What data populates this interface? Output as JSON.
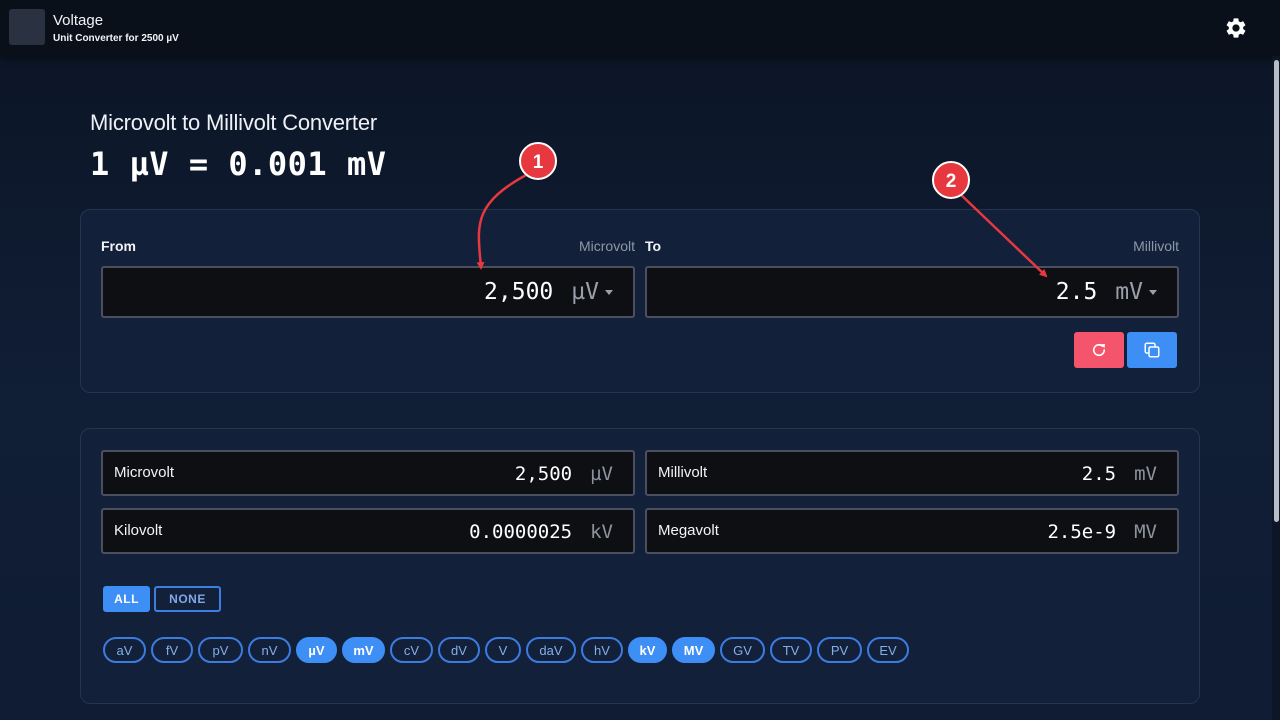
{
  "app": {
    "title": "Voltage",
    "subtitle": "Unit Converter for 2500 µV",
    "settings_icon": "gear-icon"
  },
  "main": {
    "title": "Microvolt to Millivolt Converter",
    "equation": "1 µV = 0.001 mV"
  },
  "converter": {
    "from": {
      "label": "From",
      "unit_name": "Microvolt",
      "value": "2,500",
      "unit": "µV"
    },
    "to": {
      "label": "To",
      "unit_name": "Millivolt",
      "value": "2.5",
      "unit": "mV"
    },
    "reset_icon": "refresh-icon",
    "copy_icon": "copy-icon"
  },
  "results": [
    {
      "label": "Microvolt",
      "value": "2,500",
      "unit": "µV"
    },
    {
      "label": "Millivolt",
      "value": "2.5",
      "unit": "mV"
    },
    {
      "label": "Kilovolt",
      "value": "0.0000025",
      "unit": "kV"
    },
    {
      "label": "Megavolt",
      "value": "2.5e-9",
      "unit": "MV"
    }
  ],
  "filters": {
    "all_label": "ALL",
    "none_label": "NONE",
    "units": [
      {
        "label": "aV",
        "active": false
      },
      {
        "label": "fV",
        "active": false
      },
      {
        "label": "pV",
        "active": false
      },
      {
        "label": "nV",
        "active": false
      },
      {
        "label": "µV",
        "active": true
      },
      {
        "label": "mV",
        "active": true
      },
      {
        "label": "cV",
        "active": false
      },
      {
        "label": "dV",
        "active": false
      },
      {
        "label": "V",
        "active": false
      },
      {
        "label": "daV",
        "active": false
      },
      {
        "label": "hV",
        "active": false
      },
      {
        "label": "kV",
        "active": true
      },
      {
        "label": "MV",
        "active": true
      },
      {
        "label": "GV",
        "active": false
      },
      {
        "label": "TV",
        "active": false
      },
      {
        "label": "PV",
        "active": false
      },
      {
        "label": "EV",
        "active": false
      }
    ]
  },
  "annotations": [
    {
      "number": "1"
    },
    {
      "number": "2"
    }
  ],
  "colors": {
    "accent": "#3d8ef5",
    "reset": "#f5556c",
    "marker": "#e8383f"
  }
}
